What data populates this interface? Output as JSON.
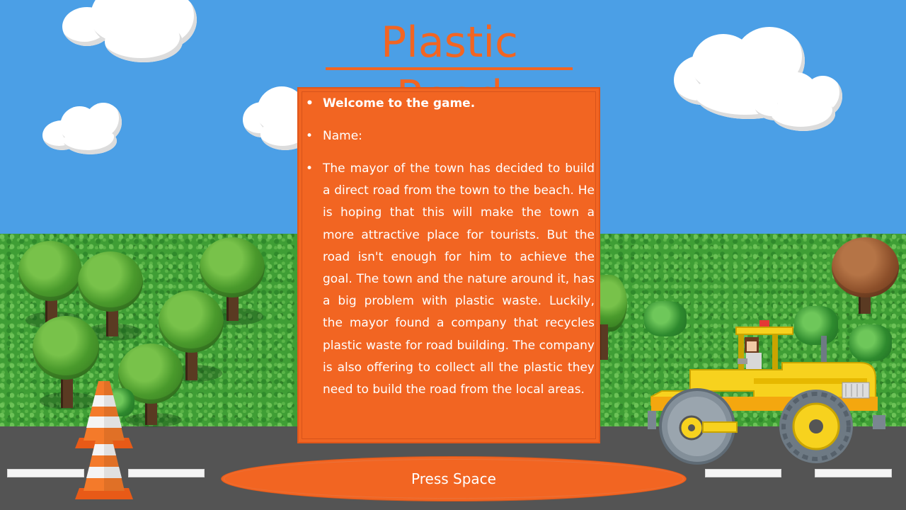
{
  "game": {
    "title": "Plastic Road",
    "intro": {
      "bullet_glyph": "•",
      "welcome": "Welcome to the game.",
      "name_label": "Name:",
      "story": "The mayor of the town has decided to build a direct road from the town to the beach. He is hoping that this will make the town a more attractive place for tourists. But the road isn't enough for him to achieve the goal. The town and the nature around it, has a big problem with plastic waste. Luckily, the mayor found a company that recycles plastic waste for road building. The company is also offering to collect all the plastic they need to build the road from the local areas."
    },
    "prompt": "Press Space"
  },
  "colors": {
    "sky": "#4b9fe6",
    "accent_orange": "#f26522",
    "grass": "#3f9e35",
    "road": "#545454",
    "roller_yellow": "#f7d21e"
  },
  "sprites": [
    "cloud",
    "tree",
    "autumn-tree",
    "bush",
    "traffic-cone",
    "road-roller",
    "driver"
  ]
}
